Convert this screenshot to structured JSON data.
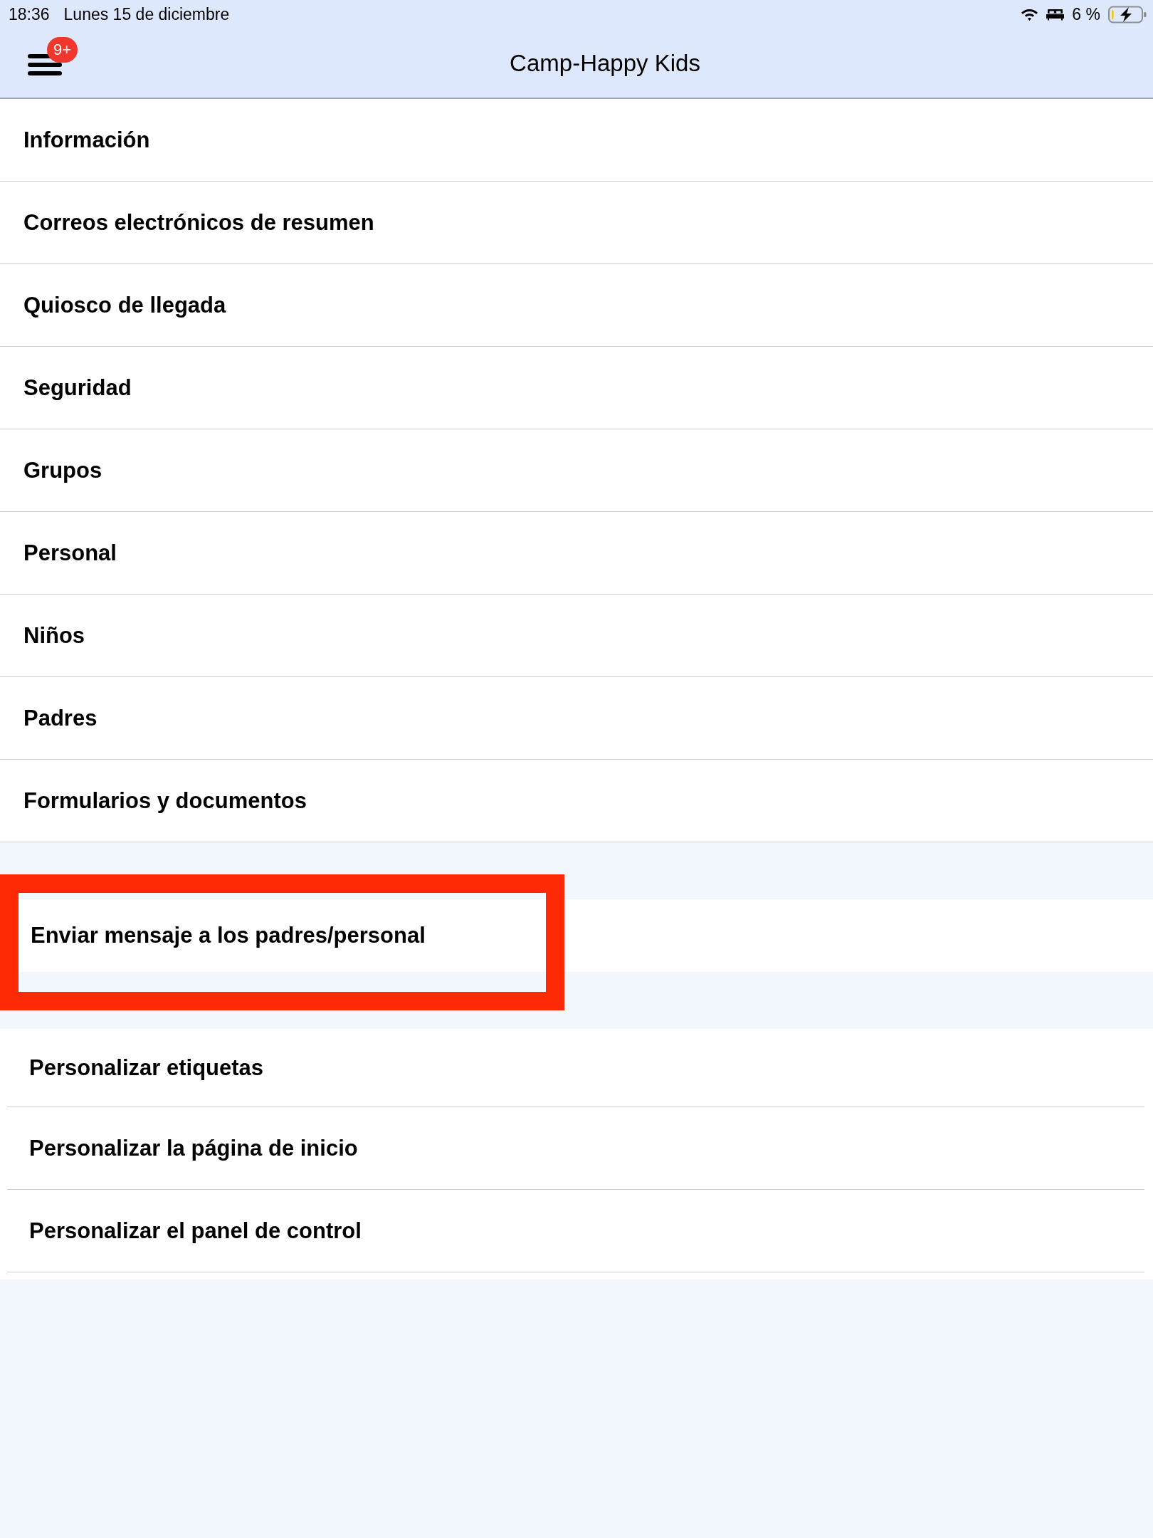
{
  "status_bar": {
    "time": "18:36",
    "date": "Lunes 15 de diciembre",
    "battery_text": "6 %"
  },
  "nav_bar": {
    "title": "Camp-Happy Kids",
    "badge": "9+"
  },
  "menu_sections": [
    {
      "items": [
        {
          "label": "Información",
          "highlighted": false
        },
        {
          "label": "Correos electrónicos de resumen",
          "highlighted": false
        },
        {
          "label": "Quiosco de llegada",
          "highlighted": false
        },
        {
          "label": "Seguridad",
          "highlighted": false
        },
        {
          "label": "Grupos",
          "highlighted": false
        },
        {
          "label": "Personal",
          "highlighted": false
        },
        {
          "label": "Niños",
          "highlighted": false
        },
        {
          "label": "Padres",
          "highlighted": false
        },
        {
          "label": "Formularios y documentos",
          "highlighted": false
        }
      ]
    },
    {
      "items": [
        {
          "label": "Enviar mensaje a los padres/personal",
          "highlighted": true
        }
      ]
    },
    {
      "items": [
        {
          "label": "Personalizar etiquetas",
          "highlighted": false
        },
        {
          "label": "Personalizar la página de inicio",
          "highlighted": false
        },
        {
          "label": "Personalizar el panel de control",
          "highlighted": false
        }
      ]
    }
  ]
}
